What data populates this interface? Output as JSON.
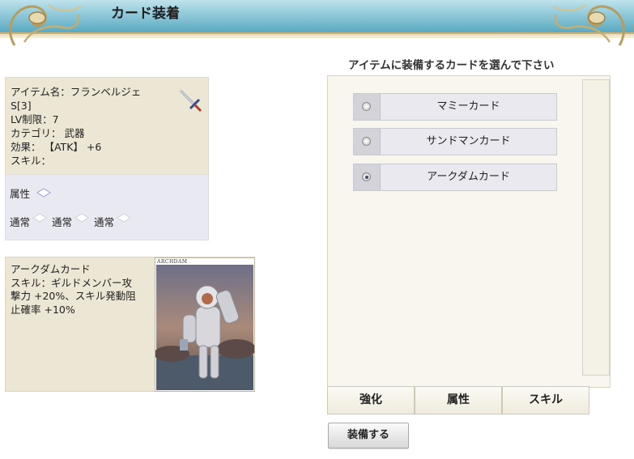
{
  "header": {
    "title": "カード装着"
  },
  "item": {
    "name": "アイテム名：フランベルジェ",
    "slots": "S[3]",
    "level": "LV制限：7",
    "category": "カテゴリ： 武器",
    "effect": "効果： 【ATK】 +6",
    "skill": "スキル：",
    "attribute_label": "属性",
    "slot_labels": [
      "通常",
      "通常",
      "通常"
    ]
  },
  "card": {
    "name": "アークダムカード",
    "description_1": "スキル：ギルドメンバー攻",
    "description_2": "撃力 +20%、スキル発動阻",
    "description_3": "止確率 +10%",
    "image_label": "ARCHDAM"
  },
  "prompt": "アイテムに装備するカードを選んで下さい",
  "options": [
    {
      "label": "マミーカード",
      "selected": false
    },
    {
      "label": "サンドマンカード",
      "selected": false
    },
    {
      "label": "アークダムカード",
      "selected": true
    }
  ],
  "tabs": [
    "強化",
    "属性",
    "スキル"
  ],
  "equip_button": "装備する"
}
